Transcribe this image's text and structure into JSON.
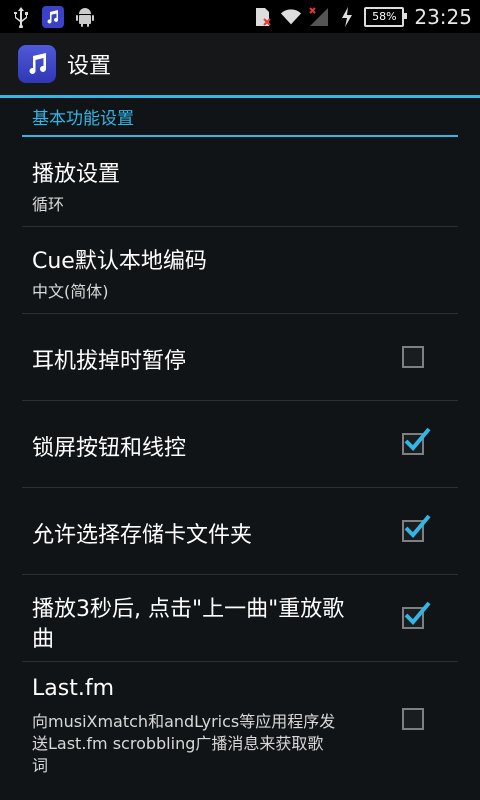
{
  "status_bar": {
    "battery": "58%",
    "time": "23:25",
    "icons": [
      "usb-icon",
      "app-music-icon",
      "android-icon",
      "sim-error-icon",
      "wifi-icon",
      "signal-icon",
      "charging-icon",
      "battery-icon"
    ]
  },
  "app_bar": {
    "title": "设置",
    "icon": "music-note-icon"
  },
  "section_header": "基本功能设置",
  "items": [
    {
      "title": "播放设置",
      "summary": "循环",
      "checkbox": null
    },
    {
      "title": "Cue默认本地编码",
      "summary": "中文(简体)",
      "checkbox": null
    },
    {
      "title": "耳机拔掉时暂停",
      "summary": "",
      "checkbox": false
    },
    {
      "title": "锁屏按钮和线控",
      "summary": "",
      "checkbox": true
    },
    {
      "title": "允许选择存储卡文件夹",
      "summary": "",
      "checkbox": true
    },
    {
      "title_lines": [
        "播放3秒后, 点击\"上一曲\"重放歌",
        "曲"
      ],
      "checkbox": true
    },
    {
      "title": "Last.fm",
      "summary_lines": [
        "向musiXmatch和andLyrics等应用程序发",
        "送Last.fm scrobbling广播消息来获取歌",
        "词"
      ],
      "checkbox": false
    }
  ],
  "colors": {
    "accent": "#33b5e5",
    "background": "#111417"
  }
}
